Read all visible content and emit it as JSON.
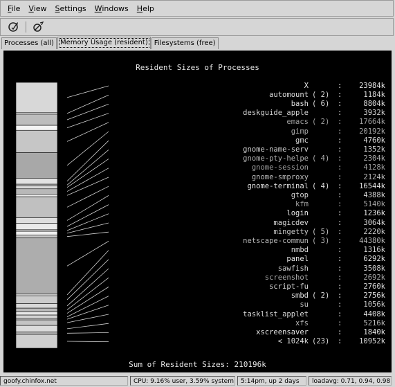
{
  "menu": [
    {
      "label": "File",
      "u": "F"
    },
    {
      "label": "View",
      "u": "V"
    },
    {
      "label": "Settings",
      "u": "S"
    },
    {
      "label": "Windows",
      "u": "W"
    },
    {
      "label": "Help",
      "u": "H"
    }
  ],
  "toolbar": {
    "icons": [
      "refresh-icon",
      "kill-process-icon"
    ]
  },
  "tabs": [
    "Processes (all)",
    "Memory Usage (resident)",
    "Filesystems (free)"
  ],
  "active_tab": 1,
  "chart_title": "Resident Sizes of Processes",
  "sum_label": "Sum of Resident Sizes: 210196k",
  "processes": [
    {
      "name": "X",
      "count": "",
      "size": "23984k"
    },
    {
      "name": "automount",
      "count": "( 2)",
      "size": "1184k"
    },
    {
      "name": "bash",
      "count": "( 6)",
      "size": "8804k"
    },
    {
      "name": "deskguide_apple",
      "count": "",
      "size": "3932k"
    },
    {
      "name": "emacs",
      "count": "( 2)",
      "size": "17664k"
    },
    {
      "name": "gimp",
      "count": "",
      "size": "20192k"
    },
    {
      "name": "gmc",
      "count": "",
      "size": "4760k"
    },
    {
      "name": "gnome-name-serv",
      "count": "",
      "size": "1352k"
    },
    {
      "name": "gnome-pty-helpe",
      "count": "( 4)",
      "size": "2304k"
    },
    {
      "name": "gnome-session",
      "count": "",
      "size": "4128k"
    },
    {
      "name": "gnome-smproxy",
      "count": "",
      "size": "2124k"
    },
    {
      "name": "gnome-terminal",
      "count": "( 4)",
      "size": "16544k"
    },
    {
      "name": "gtop",
      "count": "",
      "size": "4388k"
    },
    {
      "name": "kfm",
      "count": "",
      "size": "5140k"
    },
    {
      "name": "login",
      "count": "",
      "size": "1236k"
    },
    {
      "name": "magicdev",
      "count": "",
      "size": "3064k"
    },
    {
      "name": "mingetty",
      "count": "( 5)",
      "size": "2220k"
    },
    {
      "name": "netscape-commun",
      "count": "( 3)",
      "size": "44380k"
    },
    {
      "name": "nmbd",
      "count": "",
      "size": "1316k"
    },
    {
      "name": "panel",
      "count": "",
      "size": "6292k"
    },
    {
      "name": "sawfish",
      "count": "",
      "size": "3508k"
    },
    {
      "name": "screenshot",
      "count": "",
      "size": "2692k"
    },
    {
      "name": "script-fu",
      "count": "",
      "size": "2760k"
    },
    {
      "name": "smbd",
      "count": "( 2)",
      "size": "2756k"
    },
    {
      "name": "su",
      "count": "",
      "size": "1056k"
    },
    {
      "name": "tasklist_applet",
      "count": "",
      "size": "4408k"
    },
    {
      "name": "xfs",
      "count": "",
      "size": "5216k"
    },
    {
      "name": "xscreensaver",
      "count": "",
      "size": "1840k"
    },
    {
      "name": "< 1024k",
      "count": "(23)",
      "size": "10952k"
    }
  ],
  "chart_data": {
    "type": "bar",
    "title": "Resident Sizes of Processes",
    "categories": [
      "X",
      "automount",
      "bash",
      "deskguide_apple",
      "emacs",
      "gimp",
      "gmc",
      "gnome-name-serv",
      "gnome-pty-helpe",
      "gnome-session",
      "gnome-smproxy",
      "gnome-terminal",
      "gtop",
      "kfm",
      "login",
      "magicdev",
      "mingetty",
      "netscape-commun",
      "nmbd",
      "panel",
      "sawfish",
      "screenshot",
      "script-fu",
      "smbd",
      "su",
      "tasklist_applet",
      "xfs",
      "xscreensaver",
      "< 1024k"
    ],
    "values": [
      23984,
      1184,
      8804,
      3932,
      17664,
      20192,
      4760,
      1352,
      2304,
      4128,
      2124,
      16544,
      4388,
      5140,
      1236,
      3064,
      2220,
      44380,
      1316,
      6292,
      3508,
      2692,
      2760,
      2756,
      1056,
      4408,
      5216,
      1840,
      10952
    ],
    "unit": "k"
  },
  "status": {
    "host": "goofy.chinfox.net",
    "cpu": "CPU:  9.16% user,  3.59% system",
    "uptime": "5:14pm, up 2 days",
    "load": "loadavg: 0.71, 0.94, 0.98"
  },
  "colors": {
    "shades": [
      "#d8d8d8",
      "#eeeeee",
      "#bdbdbd",
      "#f4f4f4",
      "#c6c6c6",
      "#a8a8a8",
      "#e2e2e2",
      "#cfcfcf",
      "#dadada",
      "#b8b8b8",
      "#e8e8e8",
      "#c0c0c0",
      "#dedede",
      "#eaeaea",
      "#d2d2d2",
      "#f0f0f0",
      "#c8c8c8",
      "#adadad",
      "#e4e4e4",
      "#cccccc",
      "#d9d9d9",
      "#bcbcbc",
      "#e6e6e6",
      "#d4d4d4",
      "#eeeeee",
      "#c4c4c4",
      "#dcdcdc",
      "#b4b4b4",
      "#cfcfcf"
    ],
    "text": [
      "#e6e6e6",
      "#dcdcdc",
      "#e0e0e0",
      "#d2d2d2",
      "#a0a0a0",
      "#a8a8a8",
      "#d8d8d8",
      "#cfcfcf",
      "#b0b0b0",
      "#9e9e9e",
      "#bcbcbc",
      "#e2e2e2",
      "#d6d6d6",
      "#a4a4a4",
      "#e8e8e8",
      "#dadada",
      "#c8c8c8",
      "#b4b4b4",
      "#d4d4d4",
      "#e4e4e4",
      "#cfcfcf",
      "#a6a6a6",
      "#d8d8d8",
      "#e0e0e0",
      "#c4c4c4",
      "#dedede",
      "#b8b8b8",
      "#e6e6e6",
      "#dcdcdc"
    ]
  }
}
